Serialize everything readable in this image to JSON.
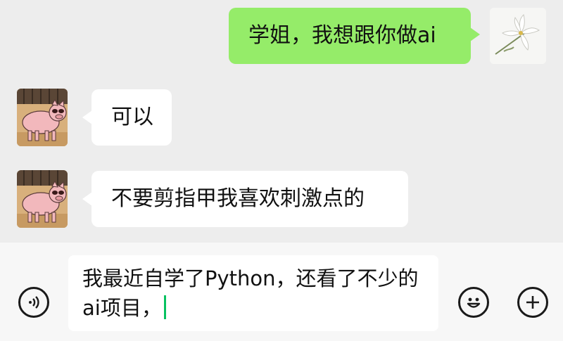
{
  "messages": [
    {
      "sender": "me",
      "text": "学姐，我想跟你做ai"
    },
    {
      "sender": "them",
      "text": "可以"
    },
    {
      "sender": "them",
      "text": "不要剪指甲我喜欢刺激点的"
    }
  ],
  "input": {
    "value": "我最近自学了Python，还看了不少的ai项目，"
  },
  "icons": {
    "voice": "voice-icon",
    "emoji": "emoji-icon",
    "add": "add-icon",
    "my_avatar": "lily-flower-avatar",
    "their_avatar": "pig-cartoon-avatar"
  },
  "colors": {
    "my_bubble": "#95ec69",
    "their_bubble": "#ffffff",
    "chat_background": "#ededed",
    "cursor": "#07c160"
  }
}
